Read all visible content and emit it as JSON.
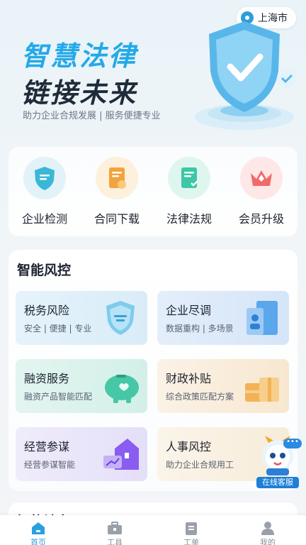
{
  "location": {
    "city": "上海市",
    "icon": "location-pin-icon"
  },
  "hero": {
    "title_line1": "智慧法律",
    "title_line2": "链接未来",
    "subtitle": "助力企业合规发展 | 服务便捷专业"
  },
  "quick_menu": [
    {
      "label": "企业检测",
      "icon": "enterprise-check-icon",
      "color": "#3ab7d6"
    },
    {
      "label": "合同下载",
      "icon": "contract-download-icon",
      "color": "#f3a33c"
    },
    {
      "label": "法律法规",
      "icon": "law-regulation-icon",
      "color": "#3cc7a5"
    },
    {
      "label": "会员升级",
      "icon": "membership-crown-icon",
      "color": "#f06a6a"
    }
  ],
  "risk_section": {
    "title": "智能风控",
    "tiles": [
      {
        "title": "税务风险",
        "subtitle": "安全 | 便捷 | 专业",
        "icon": "tax-shield-icon"
      },
      {
        "title": "企业尽调",
        "subtitle": "数据重构 | 多场景",
        "icon": "due-diligence-icon"
      },
      {
        "title": "融资服务",
        "subtitle": "融资产品智能匹配",
        "icon": "financing-piggy-icon"
      },
      {
        "title": "财政补贴",
        "subtitle": "综合政策匹配方案",
        "icon": "subsidy-gift-icon"
      },
      {
        "title": "经营参谋",
        "subtitle": "经营参谋智能",
        "icon": "business-advisor-icon"
      },
      {
        "title": "人事风控",
        "subtitle": "助力企业合规用工",
        "icon": "hr-risk-icon"
      }
    ]
  },
  "customer_service": {
    "label": "在线客服",
    "bubble": "•••",
    "icon": "mascot-service-icon"
  },
  "next_section": {
    "title": "智能法务"
  },
  "bottom_nav": [
    {
      "label": "首页",
      "icon": "home-icon",
      "active": true
    },
    {
      "label": "工具",
      "icon": "toolbox-icon",
      "active": false
    },
    {
      "label": "工单",
      "icon": "work-order-icon",
      "active": false
    },
    {
      "label": "我的",
      "icon": "profile-icon",
      "active": false
    }
  ],
  "colors": {
    "accent": "#24a9e8",
    "title_dark": "#1f2b3a"
  }
}
